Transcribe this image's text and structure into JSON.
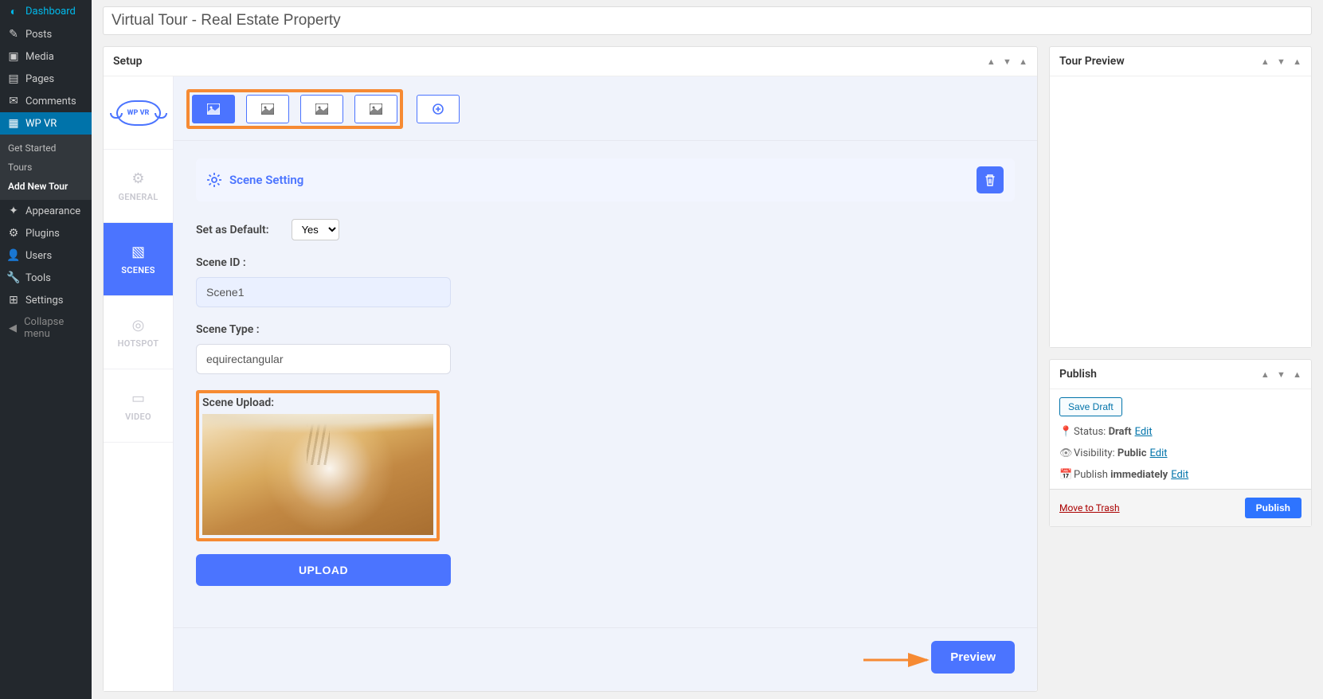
{
  "page_title": "Virtual Tour - Real Estate Property",
  "sidebar": {
    "items": [
      {
        "icon": "◐",
        "label": "Dashboard"
      },
      {
        "icon": "✎",
        "label": "Posts"
      },
      {
        "icon": "▣",
        "label": "Media"
      },
      {
        "icon": "▤",
        "label": "Pages"
      },
      {
        "icon": "✉",
        "label": "Comments"
      },
      {
        "icon": "▦",
        "label": "WP VR"
      },
      {
        "icon": "✦",
        "label": "Appearance"
      },
      {
        "icon": "⚙",
        "label": "Plugins"
      },
      {
        "icon": "👤",
        "label": "Users"
      },
      {
        "icon": "🔧",
        "label": "Tools"
      },
      {
        "icon": "⊞",
        "label": "Settings"
      }
    ],
    "submenu": [
      "Get Started",
      "Tours",
      "Add New Tour"
    ],
    "collapse": "Collapse menu"
  },
  "setup_panel": {
    "title": "Setup"
  },
  "tour_preview_panel": {
    "title": "Tour Preview"
  },
  "left_tabs": [
    "GENERAL",
    "SCENES",
    "HOTSPOT",
    "VIDEO"
  ],
  "scene_setting_label": "Scene Setting",
  "fields": {
    "default_label": "Set as Default:",
    "default_value": "Yes",
    "scene_id_label": "Scene ID :",
    "scene_id_value": "Scene1",
    "scene_type_label": "Scene Type :",
    "scene_type_value": "equirectangular",
    "scene_upload_label": "Scene Upload:"
  },
  "upload_btn": "UPLOAD",
  "preview_btn": "Preview",
  "publish_panel": {
    "title": "Publish",
    "save_draft": "Save Draft",
    "status_label": "Status:",
    "status_value": "Draft",
    "visibility_label": "Visibility:",
    "visibility_value": "Public",
    "publish_label": "Publish",
    "publish_value": "immediately",
    "edit_link": "Edit",
    "trash": "Move to Trash",
    "publish_btn": "Publish"
  }
}
